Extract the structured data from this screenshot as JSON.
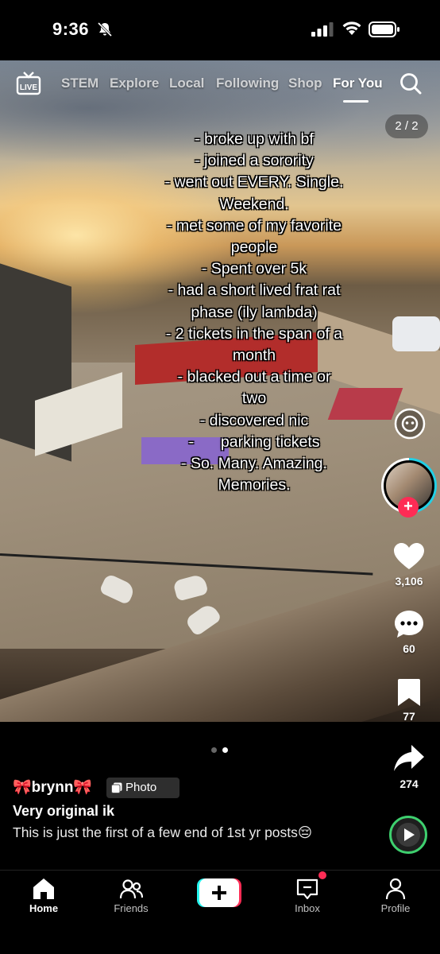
{
  "status_bar": {
    "time": "9:36"
  },
  "top_nav": {
    "live_label": "LIVE",
    "tabs": [
      {
        "label": "STEM",
        "active": false
      },
      {
        "label": "Explore",
        "active": false
      },
      {
        "label": "Local",
        "active": false
      },
      {
        "label": "Following",
        "active": false
      },
      {
        "label": "Shop",
        "active": false
      },
      {
        "label": "For You",
        "active": true
      }
    ]
  },
  "page_counter": "2 / 2",
  "caption_lines": [
    "- broke up with bf",
    "- joined a sorority",
    "- went out EVERY. Single.",
    "Weekend.",
    "- met some of my favorite",
    "people",
    "- Spent over 5k",
    "- had a short lived frat rat",
    "phase (ily lambda)",
    "- 2 tickets in the span of a",
    "month",
    "- blacked out a time or",
    "two",
    "- discovered nic",
    "- ⠀⠀parking tickets",
    "- So. Many. Amazing.",
    "Memories."
  ],
  "actions": {
    "likes": "3,106",
    "comments": "60",
    "bookmarks": "77",
    "shares": "274"
  },
  "carousel": {
    "total": 2,
    "current": 2
  },
  "post": {
    "author": "🎀brynn🎀",
    "badge": "Photo",
    "title": "Very original ik",
    "description": "This is just the first of a few end of 1st yr posts😔"
  },
  "bottom_nav": {
    "home": "Home",
    "friends": "Friends",
    "inbox": "Inbox",
    "profile": "Profile"
  },
  "colors": {
    "accent_red": "#fe2c55",
    "accent_cyan": "#22d0e6",
    "sound_ring": "#3ecf6e"
  }
}
